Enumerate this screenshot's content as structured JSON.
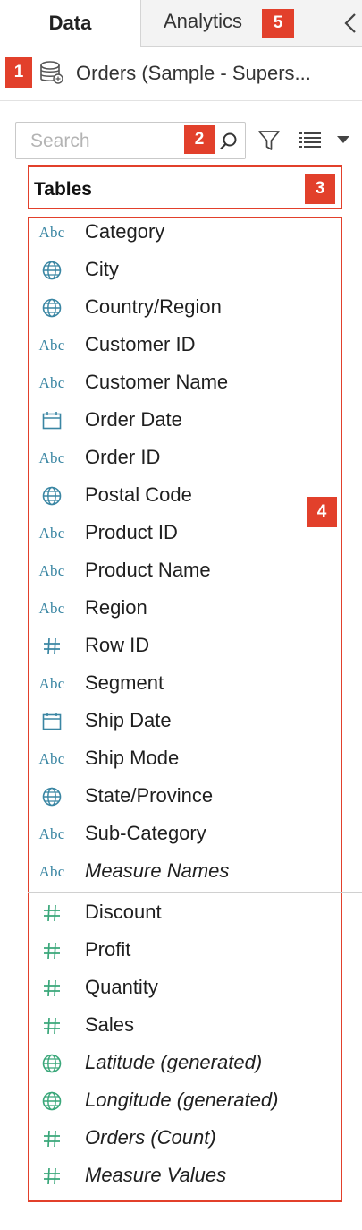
{
  "tabs": {
    "data_label": "Data",
    "analytics_label": "Analytics"
  },
  "badges": {
    "b1": "1",
    "b2": "2",
    "b3": "3",
    "b4": "4",
    "b5": "5"
  },
  "datasource": {
    "name": "Orders (Sample - Supers..."
  },
  "search": {
    "placeholder": "Search",
    "value": ""
  },
  "tables": {
    "label": "Tables"
  },
  "dimensions": [
    {
      "label": "Category",
      "icon": "abc-icon"
    },
    {
      "label": "City",
      "icon": "globe-icon"
    },
    {
      "label": "Country/Region",
      "icon": "globe-icon"
    },
    {
      "label": "Customer ID",
      "icon": "abc-icon"
    },
    {
      "label": "Customer Name",
      "icon": "abc-icon"
    },
    {
      "label": "Order Date",
      "icon": "calendar-icon"
    },
    {
      "label": "Order ID",
      "icon": "abc-icon"
    },
    {
      "label": "Postal Code",
      "icon": "globe-icon"
    },
    {
      "label": "Product ID",
      "icon": "abc-icon"
    },
    {
      "label": "Product Name",
      "icon": "abc-icon"
    },
    {
      "label": "Region",
      "icon": "abc-icon"
    },
    {
      "label": "Row ID",
      "icon": "hash-icon"
    },
    {
      "label": "Segment",
      "icon": "abc-icon"
    },
    {
      "label": "Ship Date",
      "icon": "calendar-icon"
    },
    {
      "label": "Ship Mode",
      "icon": "abc-icon"
    },
    {
      "label": "State/Province",
      "icon": "globe-icon"
    },
    {
      "label": "Sub-Category",
      "icon": "abc-icon"
    },
    {
      "label": "Measure Names",
      "icon": "abc-icon"
    }
  ],
  "measures": [
    {
      "label": "Discount",
      "icon": "hash-icon"
    },
    {
      "label": "Profit",
      "icon": "hash-icon"
    },
    {
      "label": "Quantity",
      "icon": "hash-icon"
    },
    {
      "label": "Sales",
      "icon": "hash-icon"
    },
    {
      "label": "Latitude (generated)",
      "icon": "globe-icon"
    },
    {
      "label": "Longitude (generated)",
      "icon": "globe-icon"
    },
    {
      "label": "Orders (Count)",
      "icon": "hash-icon"
    },
    {
      "label": "Measure Values",
      "icon": "hash-icon"
    }
  ],
  "abc_text": "Abc",
  "colors": {
    "dimension": "#3a86a3",
    "measure": "#3aa77a",
    "annotation": "#e2402b"
  }
}
